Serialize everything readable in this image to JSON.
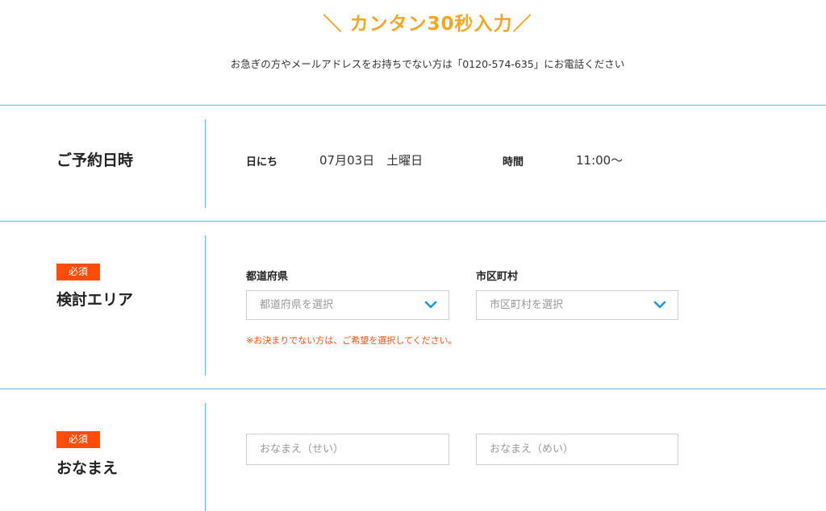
{
  "header": {
    "headline": "＼ カンタン30秒入力／",
    "subtext": "お急ぎの方やメールアドレスをお持ちでない方は「0120-574-635」にお電話ください"
  },
  "reservation": {
    "label": "ご予約日時",
    "date_label": "日にち",
    "date_value": "07月03日　土曜日",
    "time_label": "時間",
    "time_value": "11:00〜"
  },
  "area": {
    "required_badge": "必須",
    "label": "検討エリア",
    "prefecture_label": "都道府県",
    "prefecture_placeholder": "都道府県を選択",
    "city_label": "市区町村",
    "city_placeholder": "市区町村を選択",
    "note": "※お決まりでない方は、ご希望を選択してください。"
  },
  "name": {
    "required_badge": "必須",
    "label": "おなまえ",
    "last_name_placeholder": "おなまえ（せい）",
    "first_name_placeholder": "おなまえ（めい）"
  },
  "colors": {
    "accent": "#f5a623",
    "required": "#ff4e0c",
    "line": "#5bb8e0",
    "chevron": "#1a9ad6"
  }
}
